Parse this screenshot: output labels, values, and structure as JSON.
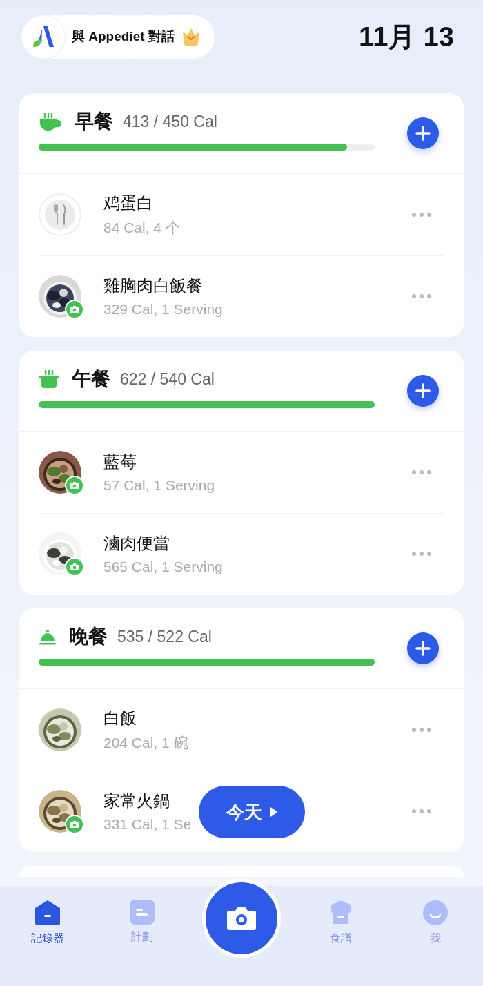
{
  "header": {
    "chat_button": "與 Appediet 對話",
    "premium": true,
    "date": "11月 13"
  },
  "meals": [
    {
      "kind": "cup",
      "name": "早餐",
      "calories": "413 / 450 Cal",
      "level": 0.918,
      "items": [
        {
          "kind": "plate",
          "photo_badge": false,
          "name": "鸡蛋白",
          "detail": "84 Cal, 4 个"
        },
        {
          "photo_badge": true,
          "name": "雞胸肉白飯餐",
          "detail": "329 Cal, 1 Serving"
        }
      ]
    },
    {
      "kind": "pot",
      "name": "午餐",
      "calories": "622 / 540 Cal",
      "level": 1,
      "items": [
        {
          "photo_badge": true,
          "name": "藍莓",
          "detail": "57 Cal, 1 Serving"
        },
        {
          "photo_badge": true,
          "name": "滷肉便當",
          "detail": "565 Cal, 1 Serving"
        }
      ]
    },
    {
      "kind": "bell",
      "name": "晚餐",
      "calories": "535 / 522 Cal",
      "level": 1,
      "items": [
        {
          "photo_badge": false,
          "name": "白飯",
          "detail": "204 Cal, 1 碗"
        },
        {
          "photo_badge": true,
          "name": "家常火鍋",
          "detail": "331 Cal, 1 Se"
        }
      ]
    }
  ],
  "today_button": "今天",
  "nav": [
    {
      "kind": "home",
      "label": "記錄器",
      "selected": true
    },
    {
      "kind": "plan",
      "label": "計劃",
      "selected": false
    },
    {
      "kind": "camera"
    },
    {
      "kind": "chef",
      "label": "食譜",
      "selected": false
    },
    {
      "kind": "face",
      "label": "我",
      "selected": false
    }
  ]
}
